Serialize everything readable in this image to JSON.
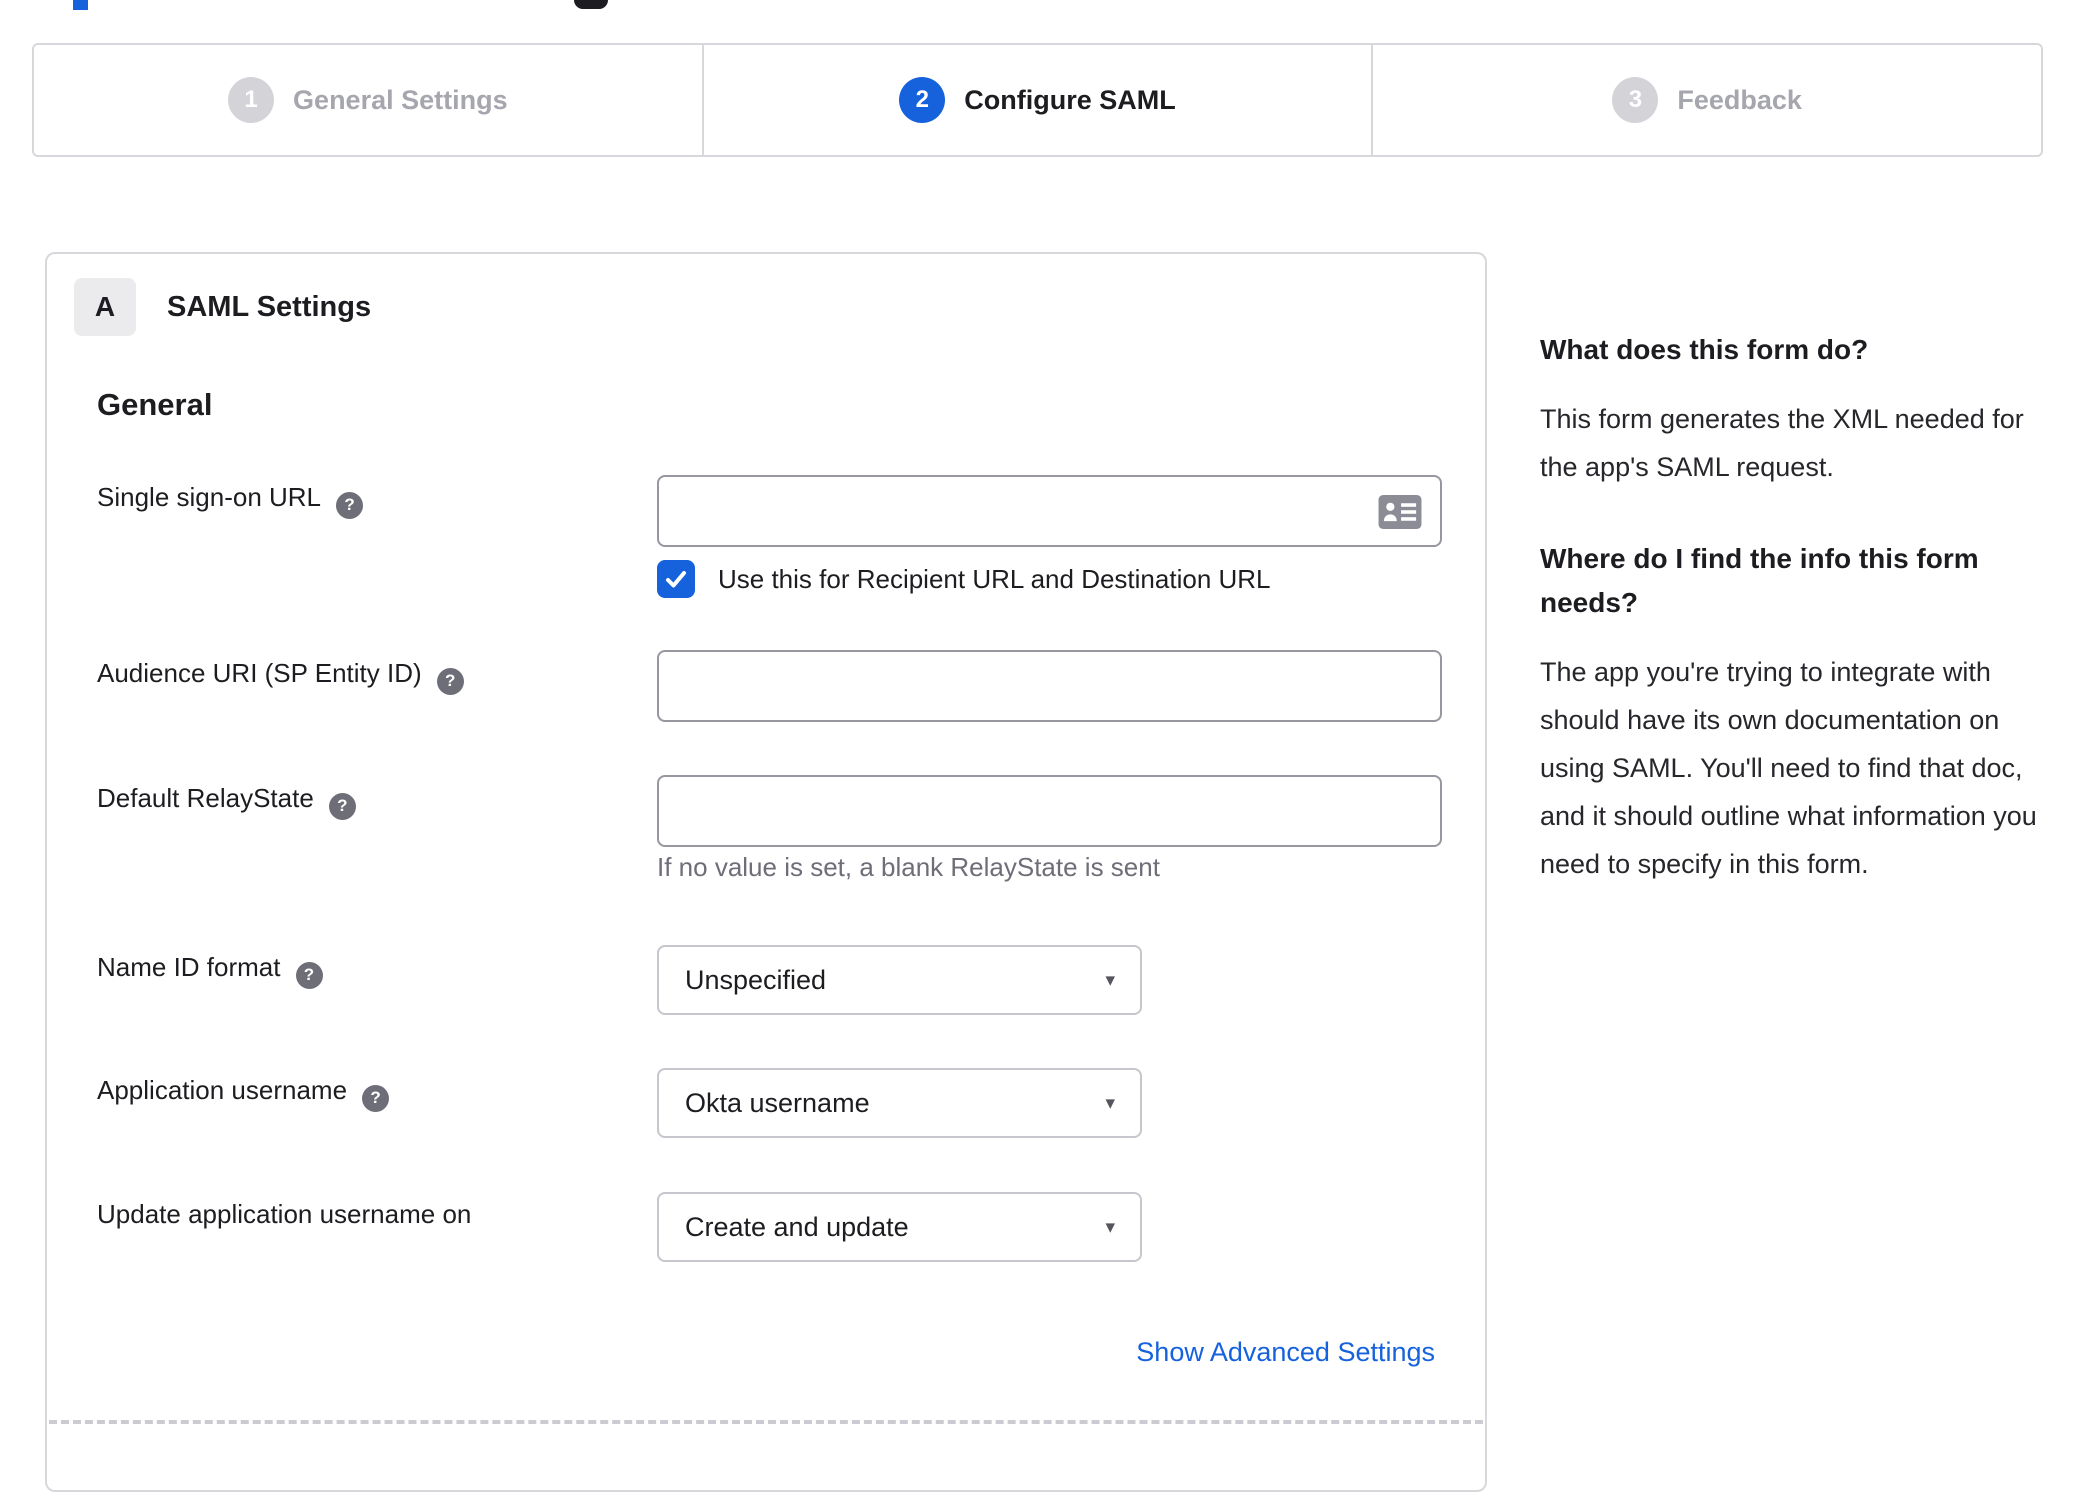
{
  "colors": {
    "accent_blue": "#1662dd",
    "panel_border": "#d8d8dc",
    "inactive_gray": "#a6a6ae",
    "help_gray": "#6e6e78",
    "text_dark": "#1d1d21"
  },
  "icons": {
    "help_glyph": "?",
    "caret_glyph": "▾",
    "sso_field_icon": "address-card"
  },
  "stepper": {
    "steps": [
      {
        "number": "1",
        "label": "General Settings",
        "state": "inactive"
      },
      {
        "number": "2",
        "label": "Configure SAML",
        "state": "active"
      },
      {
        "number": "3",
        "label": "Feedback",
        "state": "inactive"
      }
    ]
  },
  "panel": {
    "badge": "A",
    "title": "SAML Settings",
    "section_heading": "General",
    "fields": {
      "sso": {
        "label": "Single sign-on URL",
        "value": "",
        "checkbox_label": "Use this for Recipient URL and Destination URL",
        "checkbox_checked": true
      },
      "audience": {
        "label": "Audience URI (SP Entity ID)",
        "value": ""
      },
      "relay": {
        "label": "Default RelayState",
        "value": "",
        "hint": "If no value is set, a blank RelayState is sent"
      },
      "name_id": {
        "label": "Name ID format",
        "value": "Unspecified"
      },
      "app_username": {
        "label": "Application username",
        "value": "Okta username"
      },
      "update_username": {
        "label": "Update application username on",
        "value": "Create and update"
      }
    },
    "advanced_link": "Show Advanced Settings"
  },
  "sidebar": {
    "sections": [
      {
        "heading": "What does this form do?",
        "body": "This form generates the XML needed for the app's SAML request."
      },
      {
        "heading": "Where do I find the info this form needs?",
        "body": "The app you're trying to integrate with should have its own documentation on using SAML. You'll need to find that doc, and it should outline what information you need to specify in this form."
      }
    ]
  }
}
